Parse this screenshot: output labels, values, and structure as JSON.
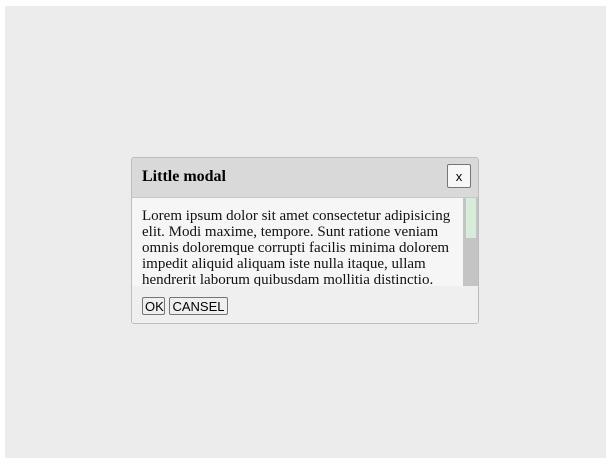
{
  "modal": {
    "title": "Little modal",
    "close_label": "x",
    "body_text": "Lorem ipsum dolor sit amet consectetur adipisicing elit. Modi maxime, tempore. Sunt ratione veniam omnis doloremque corrupti facilis minima dolorem impedit aliquid aliquam iste nulla itaque, ullam hendrerit laborum quibusdam mollitia distinctio.",
    "ok_label": "OK",
    "cancel_label": "CANSEL"
  },
  "colors": {
    "page_background": "#ececec",
    "header_background": "#d9d9d9",
    "scrollbar_thumb": "#d7ecd9"
  }
}
